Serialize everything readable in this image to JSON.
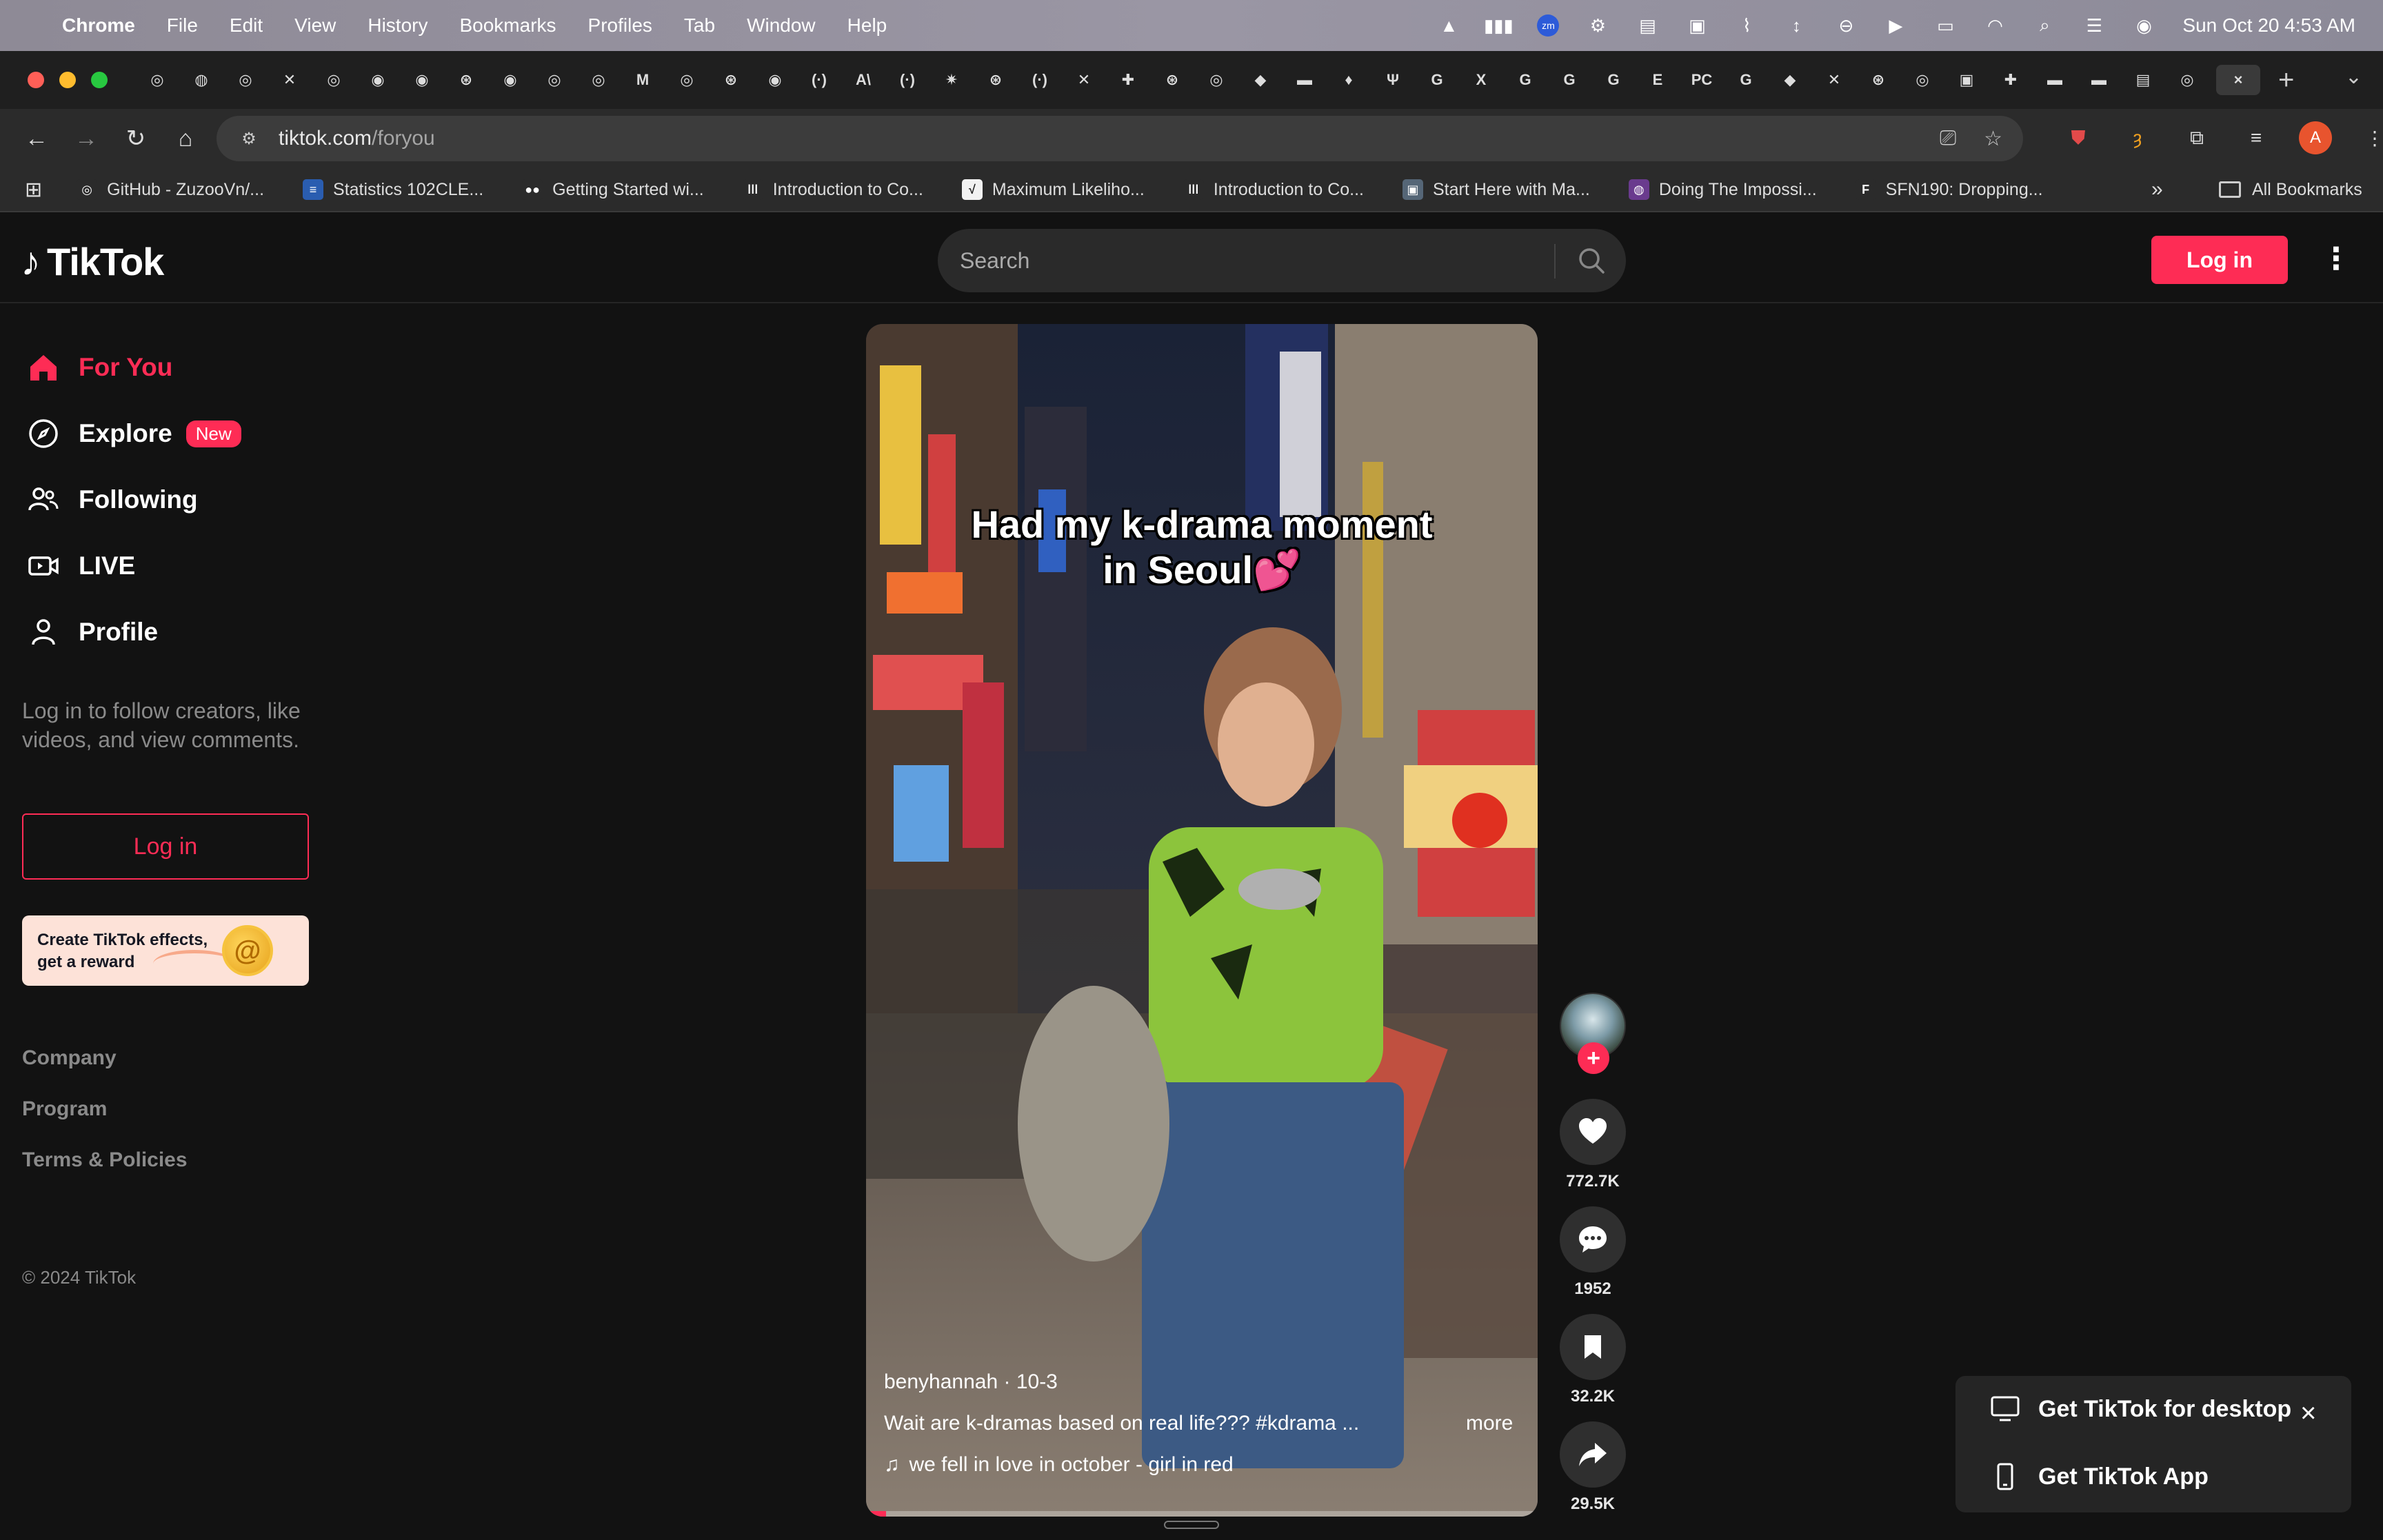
{
  "menubar": {
    "apple": "",
    "app": "Chrome",
    "items": [
      "File",
      "Edit",
      "View",
      "History",
      "Bookmarks",
      "Profiles",
      "Tab",
      "Window",
      "Help"
    ],
    "datetime": "Sun Oct 20  4:53 AM"
  },
  "tabs": {
    "favicons": [
      "◎",
      "◍",
      "◎",
      "✕",
      "◎",
      "◉",
      "◉",
      "⊛",
      "◉",
      "◎",
      "◎",
      "M",
      "◎",
      "⊛",
      "◉",
      "(·)",
      "A\\",
      "(·)",
      "✷",
      "⊛",
      "(·)",
      "✕",
      "✚",
      "⊛",
      "◎",
      "◆",
      "▬",
      "♦",
      "Ψ",
      "G",
      "X",
      "G",
      "G",
      "G",
      "E",
      "PC",
      "G",
      "◆",
      "✕",
      "⊛",
      "◎",
      "▣",
      "✚",
      "▬",
      "▬",
      "▤",
      "◎"
    ],
    "new_tab": "+",
    "close": "×"
  },
  "toolbar": {
    "url_host": "tiktok.com",
    "url_path": "/foryou",
    "avatar_letter": "A"
  },
  "bookmarks": {
    "items": [
      {
        "label": "GitHub - ZuzooVn/...",
        "icon": "◎",
        "color": "#2b2b2b"
      },
      {
        "label": "Statistics 102CLE...",
        "icon": "≡",
        "color": "#2a5db0"
      },
      {
        "label": "Getting Started wi...",
        "icon": "●●",
        "color": "#2b2b2b"
      },
      {
        "label": "Introduction to Co...",
        "icon": "ǀǀǀ",
        "color": "#2b2b2b"
      },
      {
        "label": "Maximum Likeliho...",
        "icon": "√",
        "color": "#f2f2f2"
      },
      {
        "label": "Introduction to Co...",
        "icon": "ǀǀǀ",
        "color": "#2b2b2b"
      },
      {
        "label": "Start Here with Ma...",
        "icon": "▣",
        "color": "#556677"
      },
      {
        "label": "Doing The Impossi...",
        "icon": "◍",
        "color": "#6a3b8e"
      },
      {
        "label": "SFN190: Dropping...",
        "icon": "F",
        "color": "#2b2b2b"
      }
    ],
    "more": "»",
    "all": "All Bookmarks"
  },
  "tiktok": {
    "logo": "TikTok",
    "search_placeholder": "Search",
    "login_top": "Log in",
    "nav": [
      {
        "label": "For You",
        "icon": "home-icon"
      },
      {
        "label": "Explore",
        "icon": "compass-icon",
        "badge": "New"
      },
      {
        "label": "Following",
        "icon": "following-icon"
      },
      {
        "label": "LIVE",
        "icon": "live-icon"
      },
      {
        "label": "Profile",
        "icon": "profile-icon"
      }
    ],
    "side_text": "Log in to follow creators, like videos, and view comments.",
    "side_login": "Log in",
    "effects": {
      "line1": "Create TikTok effects,",
      "line2": "get a reward",
      "coin": "@"
    },
    "footer": [
      "Company",
      "Program",
      "Terms & Policies"
    ],
    "copyright": "© 2024 TikTok"
  },
  "video": {
    "caption_line1": "Had my k-drama moment",
    "caption_line2": "in Seoul💕",
    "author_line": "benyhannah · 10-3",
    "description": "Wait are k-dramas based on real life??? #kdrama  ...",
    "more": "more",
    "music": "we fell in love in october - girl in red",
    "progress": 0.03
  },
  "actions": {
    "likes": "772.7K",
    "comments": "1952",
    "saves": "32.2K",
    "shares": "29.5K",
    "follow": "+"
  },
  "download_popup": {
    "desktop": "Get TikTok for desktop",
    "app": "Get TikTok App",
    "close": "×"
  }
}
